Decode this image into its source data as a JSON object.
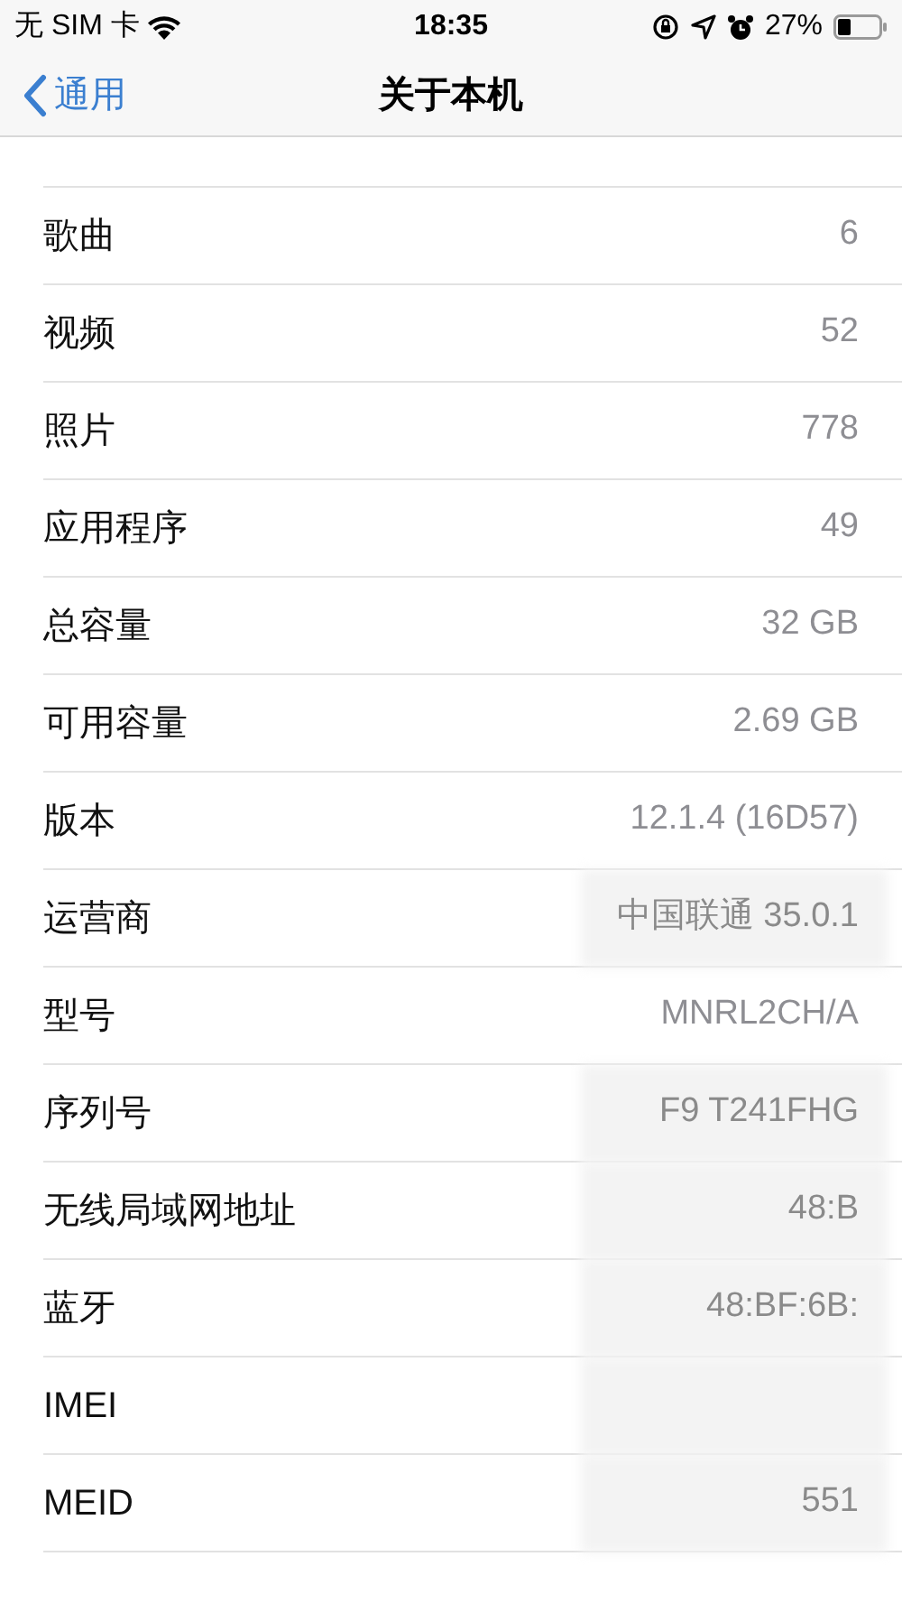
{
  "status_bar": {
    "carrier": "无 SIM 卡",
    "time": "18:35",
    "battery": "27%"
  },
  "nav": {
    "back": "通用",
    "title": "关于本机"
  },
  "rows": [
    {
      "label": "歌曲",
      "value": "6",
      "obscured": false
    },
    {
      "label": "视频",
      "value": "52",
      "obscured": false
    },
    {
      "label": "照片",
      "value": "778",
      "obscured": false
    },
    {
      "label": "应用程序",
      "value": "49",
      "obscured": false
    },
    {
      "label": "总容量",
      "value": "32 GB",
      "obscured": false
    },
    {
      "label": "可用容量",
      "value": "2.69 GB",
      "obscured": false
    },
    {
      "label": "版本",
      "value": "12.1.4 (16D57)",
      "obscured": false
    },
    {
      "label": "运营商",
      "value": "中国联通 35.0.1",
      "obscured": true
    },
    {
      "label": "型号",
      "value": "MNRL2CH/A",
      "obscured": false
    },
    {
      "label": "序列号",
      "value": "F9 T241FHG",
      "obscured": true
    },
    {
      "label": "无线局域网地址",
      "value": "48:B",
      "obscured": true
    },
    {
      "label": "蓝牙",
      "value": "48:BF:6B:",
      "obscured": true
    },
    {
      "label": "IMEI",
      "obscured": true
    },
    {
      "label": "MEID",
      "value": "551",
      "obscured": true
    }
  ]
}
